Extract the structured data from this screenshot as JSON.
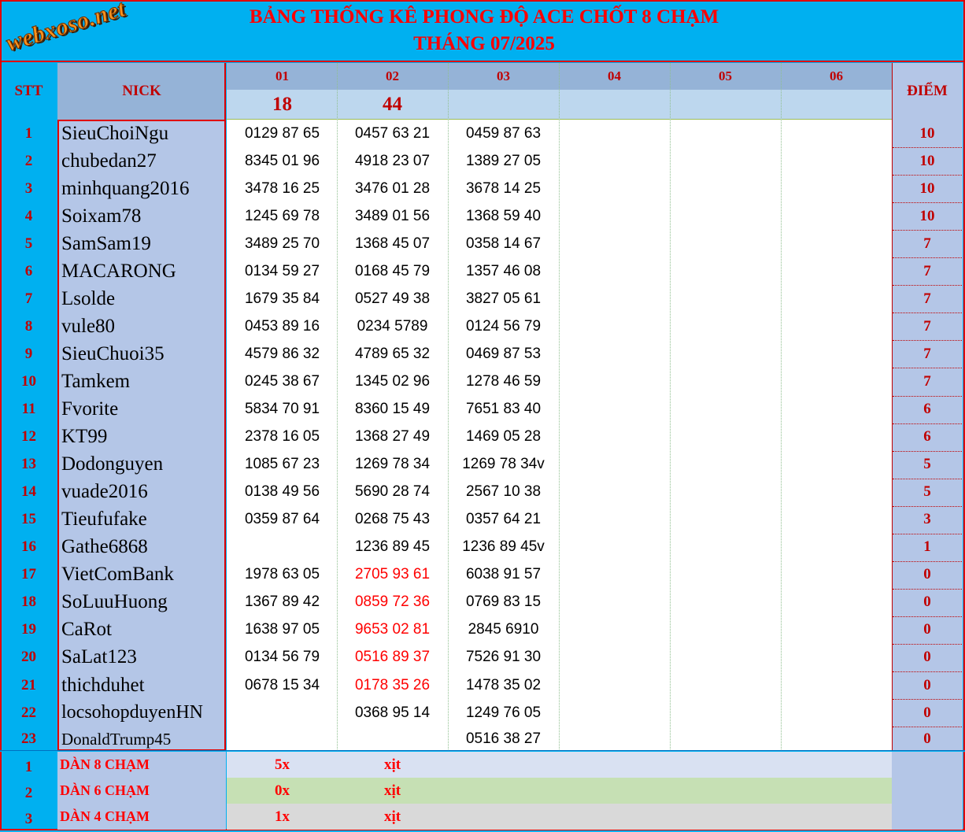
{
  "title_line1": "BẢNG THỐNG KÊ PHONG ĐỘ ACE CHỐT 8 CHẠM",
  "title_line2": "THÁNG 07/2025",
  "logo": "webxoso.net",
  "headers": {
    "stt": "STT",
    "nick": "NICK",
    "points": "ĐIỂM"
  },
  "days": [
    "01",
    "02",
    "03",
    "04",
    "05",
    "06"
  ],
  "results": [
    "18",
    "44",
    "",
    "",
    "",
    ""
  ],
  "rows": [
    {
      "stt": "1",
      "nick": "SieuChoiNgu",
      "picks": [
        "0129 87 65",
        "0457 63 21",
        "0459 87 63"
      ],
      "points": "10"
    },
    {
      "stt": "2",
      "nick": "chubedan27",
      "picks": [
        "8345 01 96",
        "4918 23 07",
        "1389 27 05"
      ],
      "points": "10"
    },
    {
      "stt": "3",
      "nick": "minhquang2016",
      "picks": [
        "3478 16 25",
        "3476 01 28",
        "3678 14 25"
      ],
      "points": "10"
    },
    {
      "stt": "4",
      "nick": "Soixam78",
      "picks": [
        "1245 69 78",
        "3489 01 56",
        "1368 59 40"
      ],
      "points": "10"
    },
    {
      "stt": "5",
      "nick": "SamSam19",
      "picks": [
        "3489 25 70",
        "1368 45 07",
        "0358 14 67"
      ],
      "points": "7"
    },
    {
      "stt": "6",
      "nick": "MACARONG",
      "picks": [
        "0134 59 27",
        "0168 45 79",
        "1357 46 08"
      ],
      "points": "7"
    },
    {
      "stt": "7",
      "nick": "Lsolde",
      "picks": [
        "1679 35 84",
        "0527 49 38",
        "3827 05 61"
      ],
      "points": "7"
    },
    {
      "stt": "8",
      "nick": "vule80",
      "picks": [
        "0453 89 16",
        "0234 5789",
        "0124 56 79"
      ],
      "points": "7"
    },
    {
      "stt": "9",
      "nick": "SieuChuoi35",
      "picks": [
        "4579 86 32",
        "4789 65 32",
        "0469 87 53"
      ],
      "points": "7"
    },
    {
      "stt": "10",
      "nick": "Tamkem",
      "picks": [
        "0245 38 67",
        "1345 02 96",
        "1278 46 59"
      ],
      "points": "7"
    },
    {
      "stt": "11",
      "nick": "Fvorite",
      "picks": [
        "5834 70 91",
        "8360 15 49",
        "7651 83 40"
      ],
      "points": "6"
    },
    {
      "stt": "12",
      "nick": "KT99",
      "picks": [
        "2378 16 05",
        "1368 27 49",
        "1469 05 28"
      ],
      "points": "6"
    },
    {
      "stt": "13",
      "nick": "Dodonguyen",
      "picks": [
        "1085 67 23",
        "1269 78 34",
        "1269 78 34v"
      ],
      "points": "5"
    },
    {
      "stt": "14",
      "nick": "vuade2016",
      "picks": [
        "0138 49 56",
        "5690 28 74",
        "2567 10 38"
      ],
      "points": "5"
    },
    {
      "stt": "15",
      "nick": "Tieufufake",
      "picks": [
        "0359 87 64",
        "0268 75 43",
        "0357 64 21"
      ],
      "points": "3"
    },
    {
      "stt": "16",
      "nick": "Gathe6868",
      "picks": [
        "",
        "1236 89 45",
        "1236 89 45v"
      ],
      "points": "1"
    },
    {
      "stt": "17",
      "nick": "VietComBank",
      "picks": [
        "1978 63 05",
        "2705 93 61",
        "6038 91 57"
      ],
      "points": "0",
      "miss": 1
    },
    {
      "stt": "18",
      "nick": "SoLuuHuong",
      "picks": [
        "1367 89 42",
        "0859 72 36",
        "0769 83 15"
      ],
      "points": "0",
      "miss": 1
    },
    {
      "stt": "19",
      "nick": "CaRot",
      "picks": [
        "1638 97 05",
        "9653 02 81",
        "2845 6910"
      ],
      "points": "0",
      "miss": 1
    },
    {
      "stt": "20",
      "nick": "SaLat123",
      "picks": [
        "0134 56 79",
        "0516 89 37",
        "7526 91 30"
      ],
      "points": "0",
      "miss": 1
    },
    {
      "stt": "21",
      "nick": "thichduhet",
      "picks": [
        "0678 15 34",
        "0178 35 26",
        "1478 35 02"
      ],
      "points": "0",
      "miss": 1
    },
    {
      "stt": "22",
      "nick": "locsohopduyenHN",
      "picks": [
        "",
        "0368 95 14",
        "1249 76 05"
      ],
      "points": "0"
    },
    {
      "stt": "23",
      "nick": "DonaldTrump45",
      "picks": [
        "",
        "",
        "0516 38 27"
      ],
      "points": "0"
    }
  ],
  "summary": [
    {
      "stt": "1",
      "label": "DÀN 8 CHẠM",
      "values": [
        "5x",
        "xịt"
      ],
      "color": "#d9e1f2"
    },
    {
      "stt": "2",
      "label": "DÀN 6 CHẠM",
      "values": [
        "0x",
        "xịt"
      ],
      "color": "#c6e0b4"
    },
    {
      "stt": "3",
      "label": "DÀN 4 CHẠM",
      "values": [
        "1x",
        "xịt"
      ],
      "color": "#d9d9d9"
    }
  ]
}
